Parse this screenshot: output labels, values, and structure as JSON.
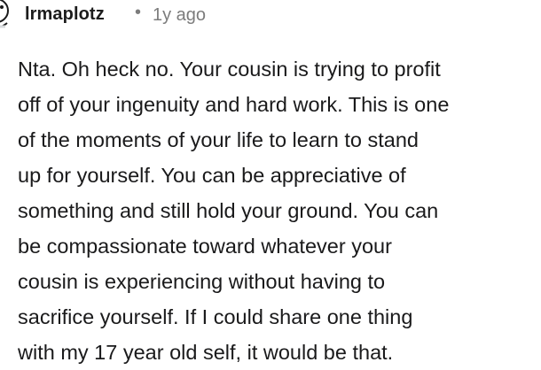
{
  "comment": {
    "author": "lrmaplotz",
    "separator": "•",
    "age": "1y ago",
    "body_lines": [
      "Nta. Oh heck no. Your cousin is trying to profit",
      "off of your ingenuity and hard work. This is one",
      "of the moments of your life to learn to stand",
      "up for yourself. You can be appreciative of",
      "something and still hold your ground. You can",
      "be compassionate toward whatever your",
      "cousin is experiencing without having to",
      "sacrifice yourself. If I could share one thing",
      "with my 17 year old self, it would be that."
    ]
  },
  "icons": {
    "avatar": "user-avatar-icon"
  }
}
